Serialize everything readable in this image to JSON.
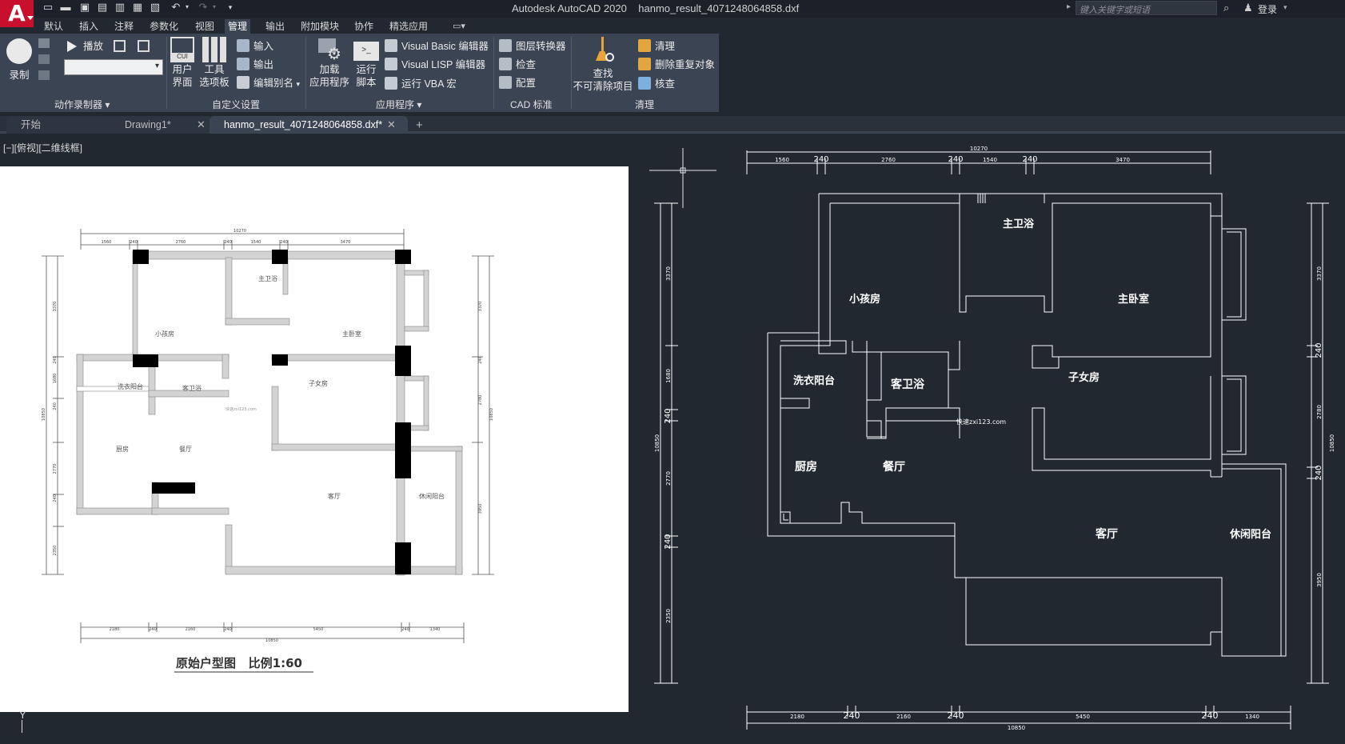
{
  "app": {
    "logo": "A",
    "title": "Autodesk AutoCAD 2020    hanmo_result_4071248064858.dxf"
  },
  "title_bar": {
    "search_placeholder": "键入关键字或短语",
    "login_label": "登录"
  },
  "ribbon_tabs": [
    {
      "label": "默认",
      "active": false
    },
    {
      "label": "插入",
      "active": false
    },
    {
      "label": "注释",
      "active": false
    },
    {
      "label": "参数化",
      "active": false
    },
    {
      "label": "视图",
      "active": false
    },
    {
      "label": "管理",
      "active": true
    },
    {
      "label": "输出",
      "active": false
    },
    {
      "label": "附加模块",
      "active": false
    },
    {
      "label": "协作",
      "active": false
    },
    {
      "label": "精选应用",
      "active": false
    }
  ],
  "ribbon": {
    "action_recorder": {
      "record_label": "录制",
      "play_label": "播放",
      "panel_title": "动作录制器"
    },
    "customization": {
      "user_interface_label": "用户\n界面",
      "user_interface_badge": "CUI",
      "tool_palettes_label": "工具\n选项板",
      "import_label": "输入",
      "export_label": "输出",
      "edit_aliases_label": "编辑别名",
      "panel_title": "自定义设置"
    },
    "applications": {
      "load_app_label": "加载\n应用程序",
      "run_script_label": "运行\n脚本",
      "vb_editor_label": "Visual Basic 编辑器",
      "lisp_editor_label": "Visual LISP 编辑器",
      "run_vba_label": "运行 VBA 宏",
      "panel_title": "应用程序"
    },
    "cad_standards": {
      "layer_translator_label": "图层转换器",
      "check_label": "检查",
      "configure_label": "配置",
      "panel_title": "CAD 标准"
    },
    "cleanup": {
      "find_label": "查找\n不可清除项目",
      "purge_label": "清理",
      "overkill_label": "删除重复对象",
      "audit_label": "核查",
      "panel_title": "清理"
    }
  },
  "doc_tabs": [
    {
      "label": "开始",
      "active": false,
      "closable": false
    },
    {
      "label": "Drawing1*",
      "active": false,
      "closable": true
    },
    {
      "label": "hanmo_result_4071248064858.dxf*",
      "active": true,
      "closable": true
    }
  ],
  "viewport": {
    "label": "[−][俯视][二维线框]",
    "ucs_label": "Y"
  },
  "drawing_left": {
    "title": "原始户型图   比例1:60",
    "overall_top": "10270",
    "top_dims": [
      "1560",
      "240",
      "2760",
      "240",
      "1540",
      "240",
      "3470"
    ],
    "bottom_dims": [
      "2180",
      "240",
      "2160",
      "240",
      "5450",
      "240",
      "1340"
    ],
    "overall_bottom": "10850",
    "left_dims": [
      "3370",
      "240",
      "1680",
      "240",
      "2770",
      "240",
      "2350"
    ],
    "right_dims": [
      "3370",
      "240",
      "2780",
      "3950"
    ],
    "overall_left": "10850",
    "overall_right": "10850",
    "rooms": [
      "主卫浴",
      "小孩房",
      "主卧室",
      "洗衣阳台",
      "客卫浴",
      "子女房",
      "厨房",
      "餐厅",
      "客厅",
      "休闲阳台"
    ],
    "watermark": "快速zxi123.com"
  },
  "drawing_right": {
    "overall_top": "10270",
    "top_dims": [
      "1560",
      "240",
      "2760",
      "240",
      "1540",
      "240",
      "3470"
    ],
    "bottom_dims": [
      "2180",
      "240",
      "2160",
      "240",
      "5450",
      "240",
      "1340"
    ],
    "overall_bottom": "10850",
    "left_dims": [
      "3370",
      "1680",
      "240",
      "2770",
      "240",
      "2350"
    ],
    "overall_left": "10850",
    "right_dims": [
      "3370",
      "240",
      "2780",
      "240",
      "3950"
    ],
    "overall_right": "10850",
    "rooms": [
      "主卫浴",
      "小孩房",
      "主卧室",
      "洗衣阳台",
      "客卫浴",
      "子女房",
      "厨房",
      "餐厅",
      "客厅",
      "休闲阳台"
    ],
    "watermark": "快速zxi123.com"
  },
  "colors": {
    "background": "#212830",
    "ribbon": "#3b4453",
    "logo": "#c8102e",
    "drawing_lines": "#ffffff",
    "plan_walls_fill": "#d3d3d3",
    "plan_columns_fill": "#000000"
  }
}
